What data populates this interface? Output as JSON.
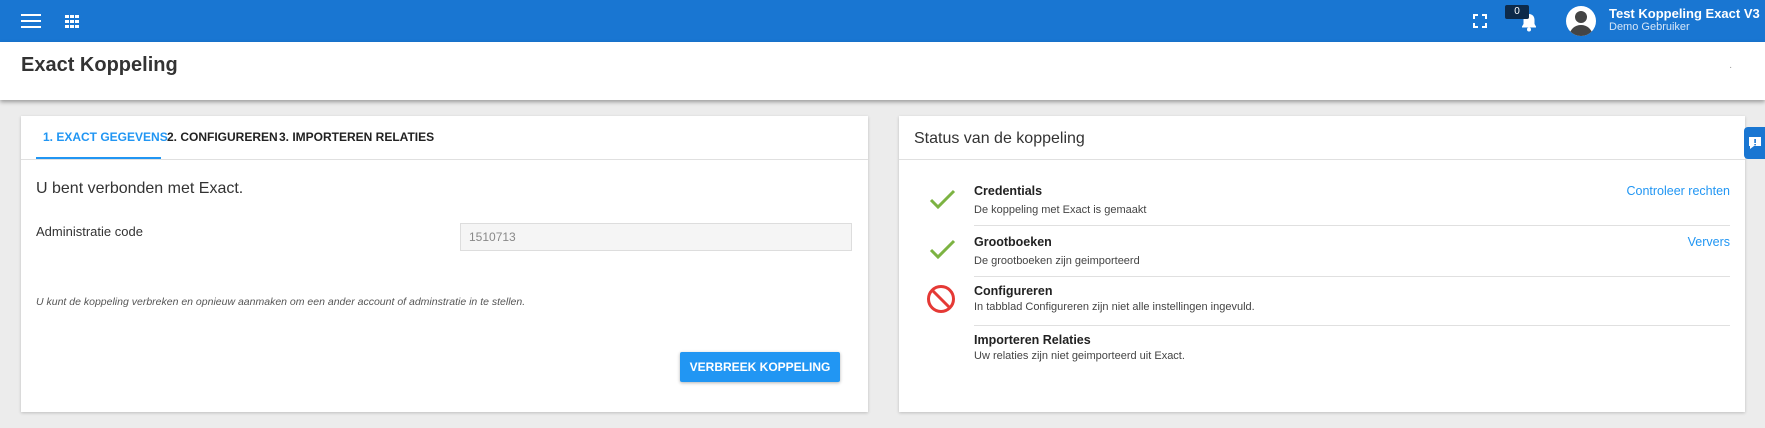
{
  "header": {
    "notification_count": "0",
    "user_name": "Test Koppeling Exact V3",
    "user_role": "Demo Gebruiker",
    "icons": [
      "menu-icon",
      "apps-icon",
      "fullscreen-icon",
      "bell-icon",
      "avatar-icon"
    ],
    "color": "#1976d2"
  },
  "page": {
    "title": "Exact Koppeling",
    "dot": "·"
  },
  "left_card": {
    "tabs": [
      {
        "label": "1. EXACT GEGEVENS",
        "active": true
      },
      {
        "label": "2. CONFIGUREREN",
        "active": false
      },
      {
        "label": "3. IMPORTEREN RELATIES",
        "active": false
      }
    ],
    "connected_text": "U bent verbonden met Exact.",
    "admin_label": "Administratie code",
    "admin_value": "1510713",
    "note": "U kunt de koppeling verbreken en opnieuw aanmaken om een ander account of adminstratie in te stellen.",
    "break_button": "VERBREEK KOPPELING",
    "accent": "#2196f3"
  },
  "right_card": {
    "title": "Status van de koppeling",
    "rows": [
      {
        "title": "Credentials",
        "subtitle": "De koppeling met Exact is gemaakt",
        "link": "Controleer rechten",
        "status": "ok"
      },
      {
        "title": "Grootboeken",
        "subtitle": "De grootboeken zijn geimporteerd",
        "link": "Ververs",
        "status": "ok"
      },
      {
        "title": "Configureren",
        "subtitle": "In tabblad Configureren zijn niet alle instellingen ingevuld.",
        "link": "",
        "status": "blocked"
      },
      {
        "title": "Importeren Relaties",
        "subtitle": "Uw relaties zijn niet geimporteerd uit Exact.",
        "link": "",
        "status": "none"
      }
    ],
    "ok_color": "#7cb342",
    "blocked_color": "#e53935"
  }
}
